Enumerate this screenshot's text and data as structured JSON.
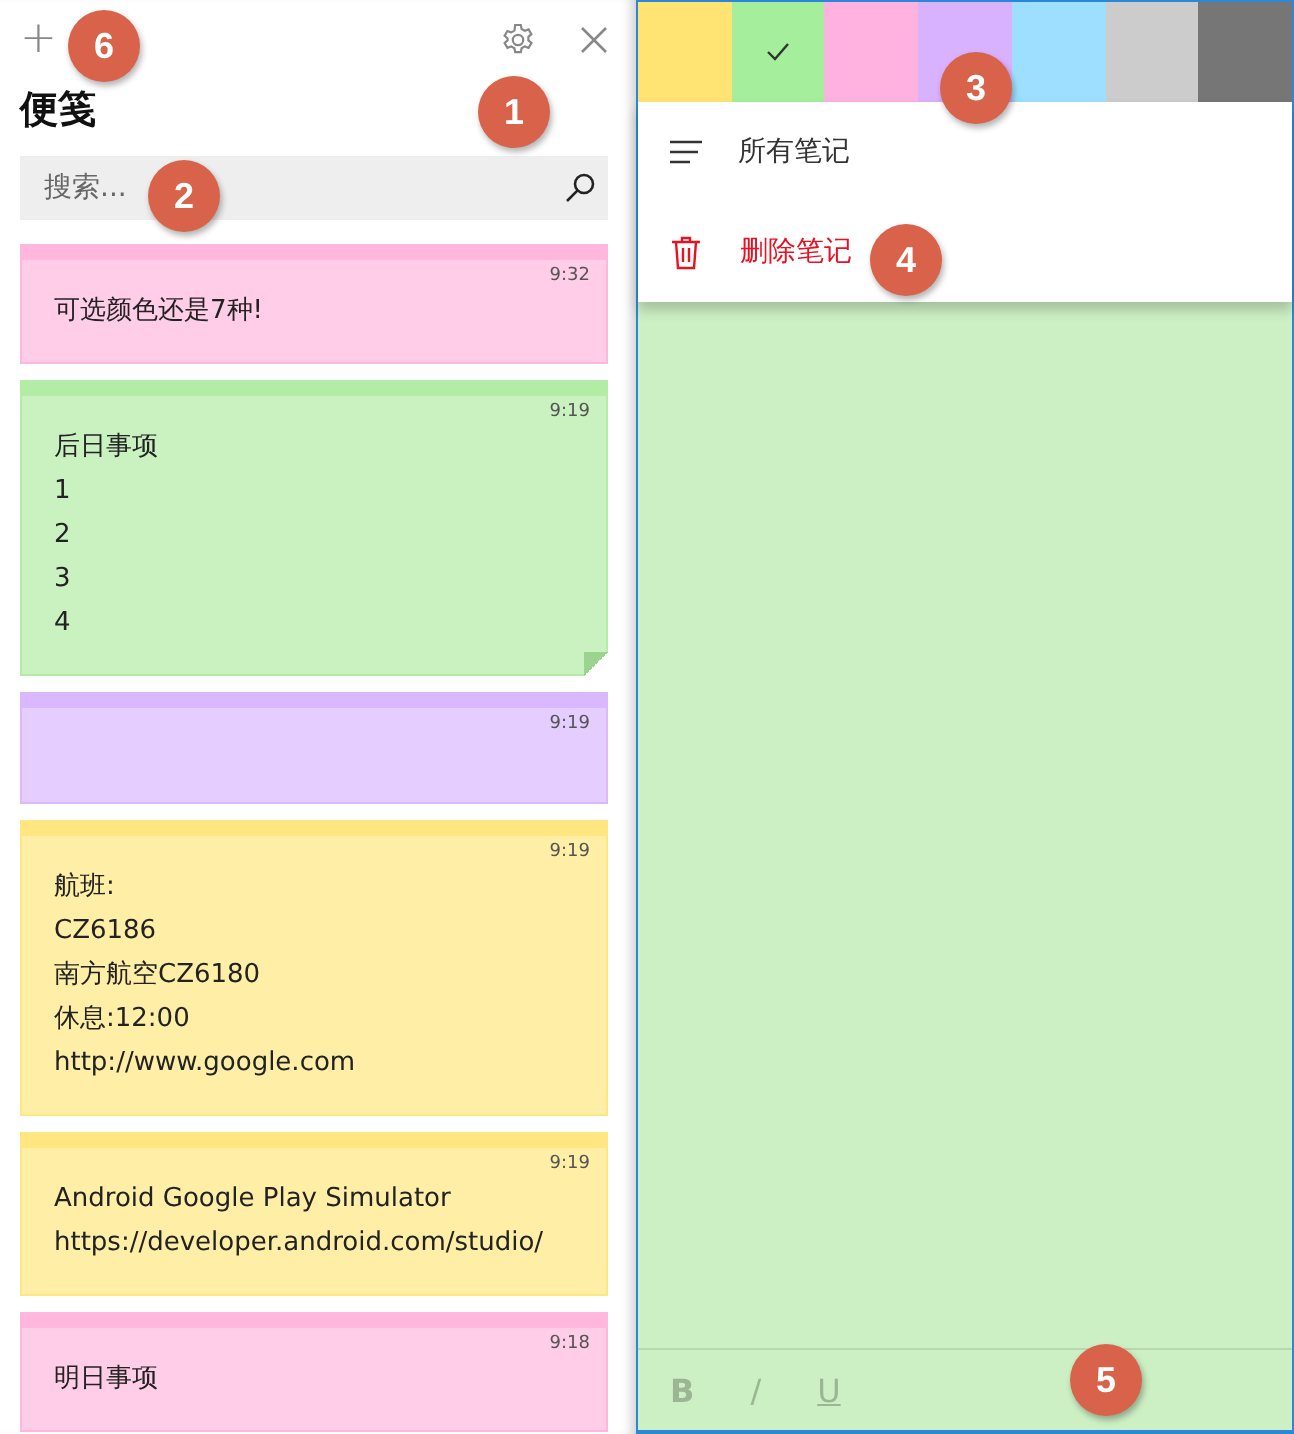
{
  "sidebar": {
    "new_button": "+",
    "title": "便笺",
    "search": {
      "placeholder": "搜索..."
    },
    "notes": [
      {
        "color": "#ffb7de",
        "time": "9:32",
        "lines": [
          "可选颜色还是7种!"
        ],
        "folded": false
      },
      {
        "color": "#b3eca5",
        "time": "9:19",
        "lines": [
          "后日事项",
          "1",
          "2",
          "3",
          "4"
        ],
        "folded": true
      },
      {
        "color": "#dab8ff",
        "time": "9:19",
        "folded": false
      },
      {
        "color": "#ffe680",
        "time": "9:19",
        "lines": [
          "航班:",
          "CZ6186",
          "南方航空CZ6180",
          "休息:12:00",
          "http://www.google.com"
        ],
        "folded": false
      },
      {
        "color": "#ffe680",
        "time": "9:19",
        "lines": [
          "Android Google Play Simulator",
          "https://developer.android.com/studio/"
        ],
        "folded": false
      },
      {
        "color": "#ffb7de",
        "time": "9:18",
        "lines": [
          "明日事项"
        ],
        "folded": false
      }
    ]
  },
  "note_editor": {
    "color": "#ccf0c4",
    "swatches": [
      {
        "color": "#ffe473",
        "selected": false
      },
      {
        "color": "#a5ee9b",
        "selected": true
      },
      {
        "color": "#ffb1e0",
        "selected": false
      },
      {
        "color": "#d9b2ff",
        "selected": false
      },
      {
        "color": "#9edfff",
        "selected": false
      },
      {
        "color": "#cccccc",
        "selected": false
      },
      {
        "color": "#767676",
        "selected": false
      }
    ],
    "menu": [
      {
        "kind": "list",
        "label": "所有笔记"
      },
      {
        "kind": "delete",
        "label": "删除笔记"
      }
    ],
    "toolbar": [
      {
        "kind": "bold",
        "label": "B"
      },
      {
        "kind": "italic",
        "label": "/"
      },
      {
        "kind": "underline",
        "label": "U"
      }
    ]
  },
  "callouts": [
    "6",
    "1",
    "2",
    "3",
    "4",
    "5"
  ]
}
